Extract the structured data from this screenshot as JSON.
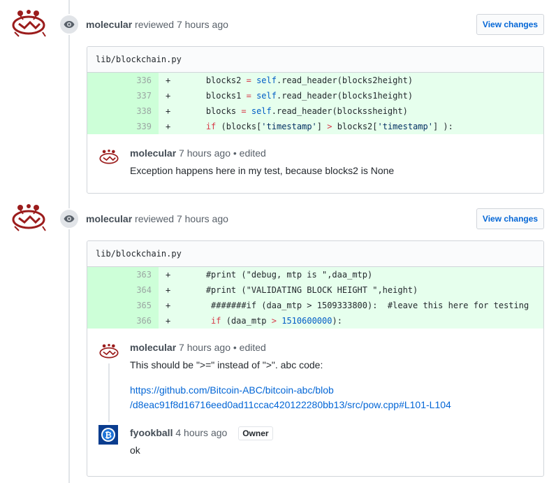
{
  "reviews": [
    {
      "author": "molecular",
      "action": "reviewed",
      "time": "7 hours ago",
      "view_changes": "View changes",
      "file": "lib/blockchain.py",
      "diff": [
        {
          "num": "336",
          "sign": "+"
        },
        {
          "num": "337",
          "sign": "+"
        },
        {
          "num": "338",
          "sign": "+"
        },
        {
          "num": "339",
          "sign": "+"
        }
      ],
      "comments": [
        {
          "author": "molecular",
          "meta": "7 hours ago • edited",
          "body": "Exception happens here in my test, because blocks2 is None"
        }
      ]
    },
    {
      "author": "molecular",
      "action": "reviewed",
      "time": "7 hours ago",
      "view_changes": "View changes",
      "file": "lib/blockchain.py",
      "diff": [
        {
          "num": "363",
          "sign": "+"
        },
        {
          "num": "364",
          "sign": "+"
        },
        {
          "num": "365",
          "sign": "+"
        },
        {
          "num": "366",
          "sign": "+"
        }
      ],
      "comments": [
        {
          "author": "molecular",
          "meta": "7 hours ago • edited",
          "body": "This should be \">=\" instead of \">\". abc code:",
          "link1": "https://github.com/Bitcoin-ABC/bitcoin-abc/blob",
          "link2": "/d8eac91f8d16716eed0ad11ccac420122280bb13/src/pow.cpp#L101-L104"
        },
        {
          "author": "fyookball",
          "meta": "4 hours ago",
          "badge": "Owner",
          "body": "ok"
        }
      ]
    }
  ],
  "code": {
    "r0l0": [
      "blocks2",
      " = ",
      "self",
      ".read_header(blocks2height)"
    ],
    "r0l1": [
      "blocks1",
      " = ",
      "self",
      ".read_header(blocks1height)"
    ],
    "r0l2": [
      "blocks",
      " = ",
      "self",
      ".read_header(blockssheight)"
    ],
    "r0l3": [
      "if",
      " (blocks[",
      "'timestamp'",
      "] ",
      ">",
      " blocks2[",
      "'timestamp'",
      "] ):"
    ],
    "r1l0": "#print (\"debug, mtp is \",daa_mtp)",
    "r1l1": "#print (\"VALIDATING BLOCK HEIGHT \",height)",
    "r1l2": " #######if (daa_mtp > 1509333800):  #leave this here for testing",
    "r1l3": [
      " if",
      " (daa_mtp ",
      ">",
      " ",
      "1510600000",
      "):"
    ]
  },
  "colors": {
    "addition_bg": "#e6ffed",
    "addition_num_bg": "#cdffd8",
    "link": "#0366d6",
    "avatar_red": "#9b1c1c"
  }
}
